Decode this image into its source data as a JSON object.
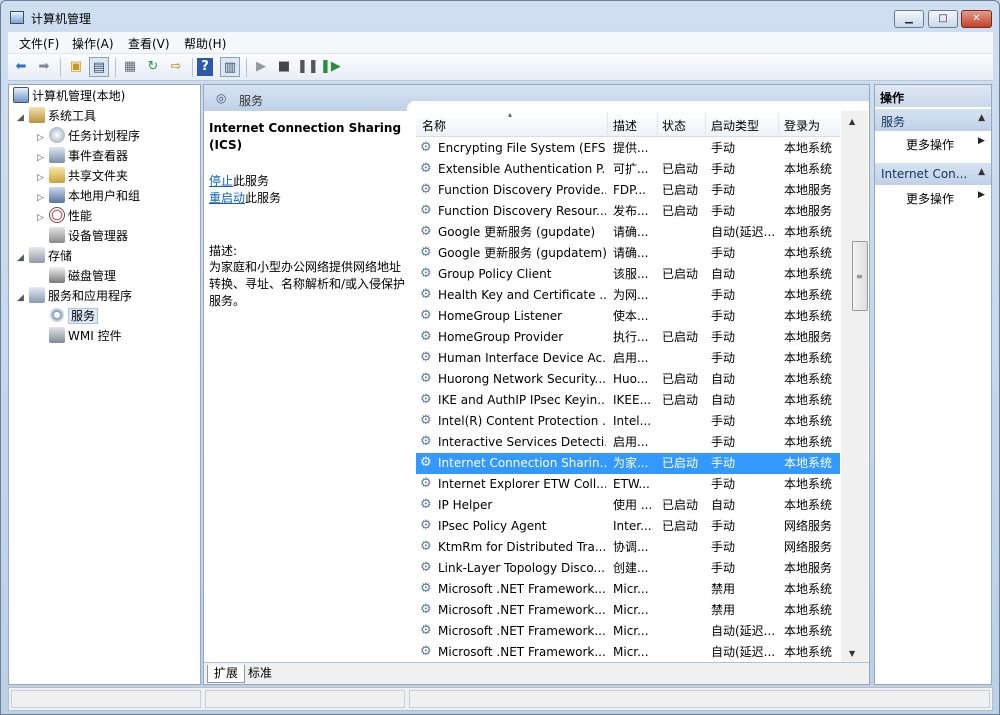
{
  "window": {
    "title": "计算机管理"
  },
  "menu": [
    "文件(F)",
    "操作(A)",
    "查看(V)",
    "帮助(H)"
  ],
  "toolbar": {
    "icons": [
      "back-icon",
      "forward-icon",
      "up-icon",
      "show-tree-icon",
      "export-icon",
      "refresh-icon",
      "export-list-icon",
      "help-icon",
      "show-action-pane-icon",
      "start-service-icon",
      "stop-service-icon",
      "pause-service-icon",
      "restart-service-icon"
    ]
  },
  "tree": {
    "root": "计算机管理(本地)",
    "system_tools": "系统工具",
    "task_scheduler": "任务计划程序",
    "event_viewer": "事件查看器",
    "shared_folders": "共享文件夹",
    "local_users": "本地用户和组",
    "performance": "性能",
    "device_manager": "设备管理器",
    "storage": "存储",
    "disk_management": "磁盘管理",
    "services_apps": "服务和应用程序",
    "services": "服务",
    "wmi": "WMI 控件"
  },
  "center": {
    "header": "服务",
    "selected_title": "Internet Connection Sharing (ICS)",
    "stop_link": "停止",
    "stop_suffix": "此服务",
    "restart_link": "重启动",
    "restart_suffix": "此服务",
    "desc_label": "描述:",
    "desc_body": "为家庭和小型办公网络提供网络地址转换、寻址、名称解析和/或入侵保护服务。"
  },
  "columns": {
    "name": "名称",
    "desc": "描述",
    "status": "状态",
    "startup": "启动类型",
    "logon": "登录为"
  },
  "services": [
    {
      "name": "Encrypting File System (EFS)",
      "desc": "提供...",
      "status": "",
      "startup": "手动",
      "logon": "本地系统"
    },
    {
      "name": "Extensible Authentication P...",
      "desc": "可扩...",
      "status": "已启动",
      "startup": "手动",
      "logon": "本地系统"
    },
    {
      "name": "Function Discovery Provide...",
      "desc": "FDP...",
      "status": "已启动",
      "startup": "手动",
      "logon": "本地服务"
    },
    {
      "name": "Function Discovery Resour...",
      "desc": "发布...",
      "status": "已启动",
      "startup": "手动",
      "logon": "本地服务"
    },
    {
      "name": "Google 更新服务 (gupdate)",
      "desc": "请确...",
      "status": "",
      "startup": "自动(延迟...",
      "logon": "本地系统"
    },
    {
      "name": "Google 更新服务 (gupdatem)",
      "desc": "请确...",
      "status": "",
      "startup": "手动",
      "logon": "本地系统"
    },
    {
      "name": "Group Policy Client",
      "desc": "该服...",
      "status": "已启动",
      "startup": "自动",
      "logon": "本地系统"
    },
    {
      "name": "Health Key and Certificate ...",
      "desc": "为网...",
      "status": "",
      "startup": "手动",
      "logon": "本地系统"
    },
    {
      "name": "HomeGroup Listener",
      "desc": "使本...",
      "status": "",
      "startup": "手动",
      "logon": "本地系统"
    },
    {
      "name": "HomeGroup Provider",
      "desc": "执行...",
      "status": "已启动",
      "startup": "手动",
      "logon": "本地服务"
    },
    {
      "name": "Human Interface Device Ac...",
      "desc": "启用...",
      "status": "",
      "startup": "手动",
      "logon": "本地系统"
    },
    {
      "name": "Huorong Network Security...",
      "desc": "Huo...",
      "status": "已启动",
      "startup": "自动",
      "logon": "本地系统"
    },
    {
      "name": "IKE and AuthIP IPsec Keyin...",
      "desc": "IKEE...",
      "status": "已启动",
      "startup": "自动",
      "logon": "本地系统"
    },
    {
      "name": "Intel(R) Content Protection ...",
      "desc": "Intel...",
      "status": "",
      "startup": "手动",
      "logon": "本地系统"
    },
    {
      "name": "Interactive Services Detecti...",
      "desc": "启用...",
      "status": "",
      "startup": "手动",
      "logon": "本地系统"
    },
    {
      "name": "Internet Connection Sharin...",
      "desc": "为家...",
      "status": "已启动",
      "startup": "手动",
      "logon": "本地系统",
      "selected": true
    },
    {
      "name": "Internet Explorer ETW Coll...",
      "desc": "ETW...",
      "status": "",
      "startup": "手动",
      "logon": "本地系统"
    },
    {
      "name": "IP Helper",
      "desc": "使用 ...",
      "status": "已启动",
      "startup": "自动",
      "logon": "本地系统"
    },
    {
      "name": "IPsec Policy Agent",
      "desc": "Inter...",
      "status": "已启动",
      "startup": "手动",
      "logon": "网络服务"
    },
    {
      "name": "KtmRm for Distributed Tra...",
      "desc": "协调...",
      "status": "",
      "startup": "手动",
      "logon": "网络服务"
    },
    {
      "name": "Link-Layer Topology Disco...",
      "desc": "创建...",
      "status": "",
      "startup": "手动",
      "logon": "本地服务"
    },
    {
      "name": "Microsoft .NET Framework...",
      "desc": "Micr...",
      "status": "",
      "startup": "禁用",
      "logon": "本地系统"
    },
    {
      "name": "Microsoft .NET Framework...",
      "desc": "Micr...",
      "status": "",
      "startup": "禁用",
      "logon": "本地系统"
    },
    {
      "name": "Microsoft .NET Framework...",
      "desc": "Micr...",
      "status": "",
      "startup": "自动(延迟...",
      "logon": "本地系统"
    },
    {
      "name": "Microsoft .NET Framework...",
      "desc": "Micr...",
      "status": "",
      "startup": "自动(延迟...",
      "logon": "本地系统"
    }
  ],
  "tabs": [
    "扩展",
    "标准"
  ],
  "actions": {
    "title": "操作",
    "section1": "服务",
    "more1": "更多操作",
    "section2": "Internet Con...",
    "more2": "更多操作"
  }
}
